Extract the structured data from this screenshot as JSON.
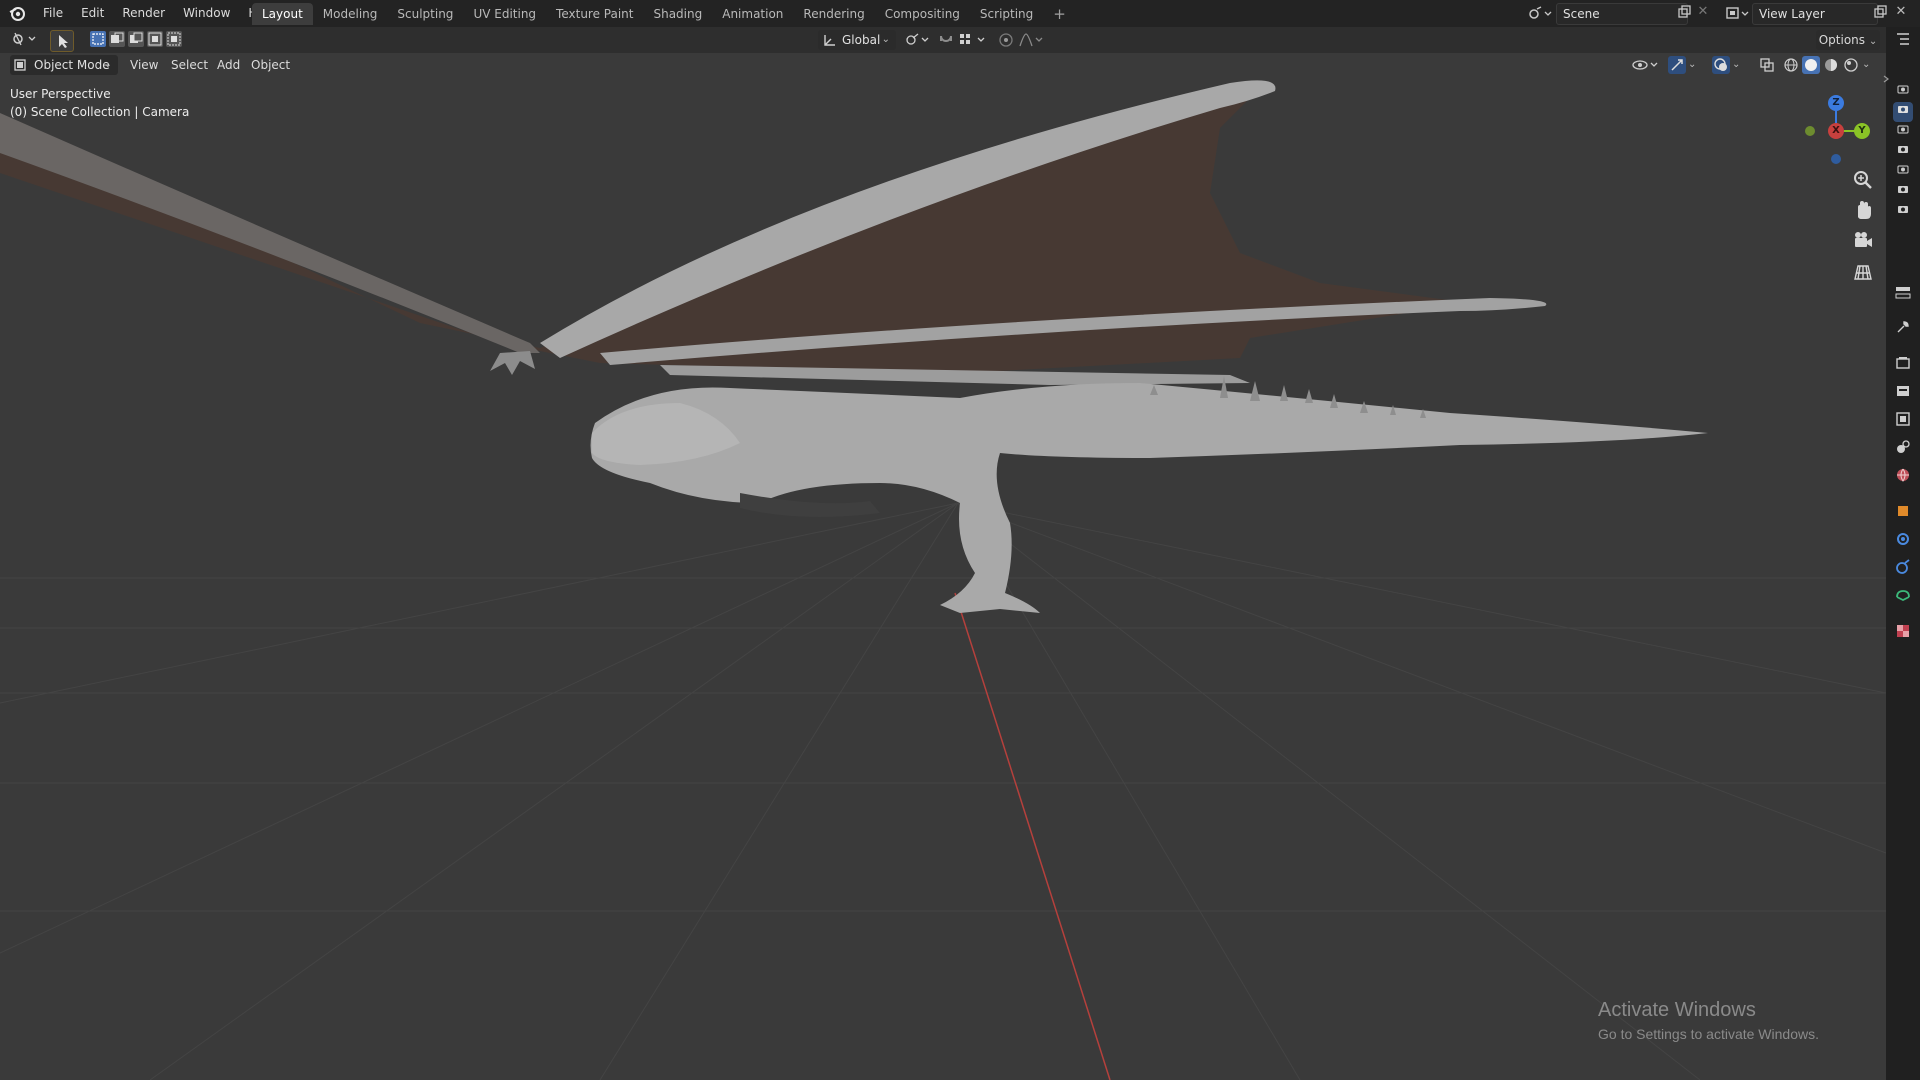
{
  "menu": {
    "items": [
      "File",
      "Edit",
      "Render",
      "Window",
      "Help"
    ]
  },
  "workspaces": {
    "tabs": [
      "Layout",
      "Modeling",
      "Sculpting",
      "UV Editing",
      "Texture Paint",
      "Shading",
      "Animation",
      "Rendering",
      "Compositing",
      "Scripting"
    ],
    "active": "Layout",
    "add_label": "+"
  },
  "scene": {
    "name": "Scene"
  },
  "view_layer": {
    "name": "View Layer"
  },
  "tool_header": {
    "orientation": "Global",
    "options_label": "Options"
  },
  "viewport_header": {
    "mode": "Object Mode",
    "menus": [
      "View",
      "Select",
      "Add",
      "Object"
    ]
  },
  "viewport": {
    "perspective": "User Perspective",
    "collection_info": "(0) Scene Collection | Camera",
    "gizmo": {
      "z": "Z",
      "x": "X",
      "y": "Y"
    }
  },
  "watermark": {
    "title": "Activate Windows",
    "subtitle": "Go to Settings to activate Windows."
  },
  "colors": {
    "topbar": "#232323",
    "viewport_bg": "#3a3a3a",
    "active_tab": "#3d3d3d",
    "x_axis": "#c8403e",
    "y_axis": "#8ac326",
    "z_axis": "#3b7be0"
  },
  "icons": {
    "right_tabs": [
      "tool-icon",
      "render-icon",
      "output-icon",
      "view-layer-icon",
      "scene-icon",
      "world-icon",
      "object-icon",
      "modifier-icon",
      "particles-icon",
      "physics-icon",
      "constraints-icon",
      "data-icon",
      "material-icon"
    ],
    "nav": [
      "zoom-icon",
      "pan-icon",
      "camera-icon",
      "grid-icon"
    ]
  }
}
